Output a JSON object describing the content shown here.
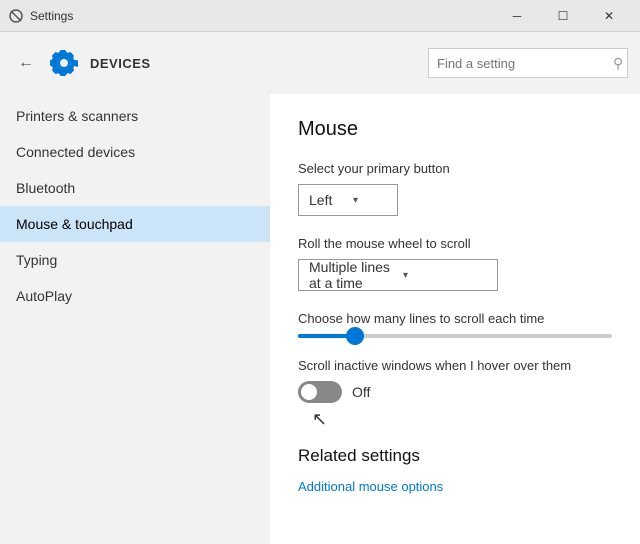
{
  "titlebar": {
    "title": "Settings",
    "minimize_label": "─",
    "maximize_label": "☐",
    "close_label": "✕"
  },
  "header": {
    "back_icon": "←",
    "title": "DEVICES",
    "search_placeholder": "Find a setting",
    "search_icon": "🔍"
  },
  "sidebar": {
    "items": [
      {
        "label": "Printers & scanners",
        "active": false
      },
      {
        "label": "Connected devices",
        "active": false
      },
      {
        "label": "Bluetooth",
        "active": false
      },
      {
        "label": "Mouse & touchpad",
        "active": true
      },
      {
        "label": "Typing",
        "active": false
      },
      {
        "label": "AutoPlay",
        "active": false
      }
    ]
  },
  "content": {
    "title": "Mouse",
    "primary_button_label": "Select your primary button",
    "primary_button_value": "Left",
    "scroll_label": "Roll the mouse wheel to scroll",
    "scroll_value": "Multiple lines at a time",
    "lines_label": "Choose how many lines to scroll each time",
    "inactive_scroll_label": "Scroll inactive windows when I hover over them",
    "toggle_state": "Off",
    "related_title": "Related settings",
    "additional_link": "Additional mouse options",
    "slider_percent": 18
  }
}
